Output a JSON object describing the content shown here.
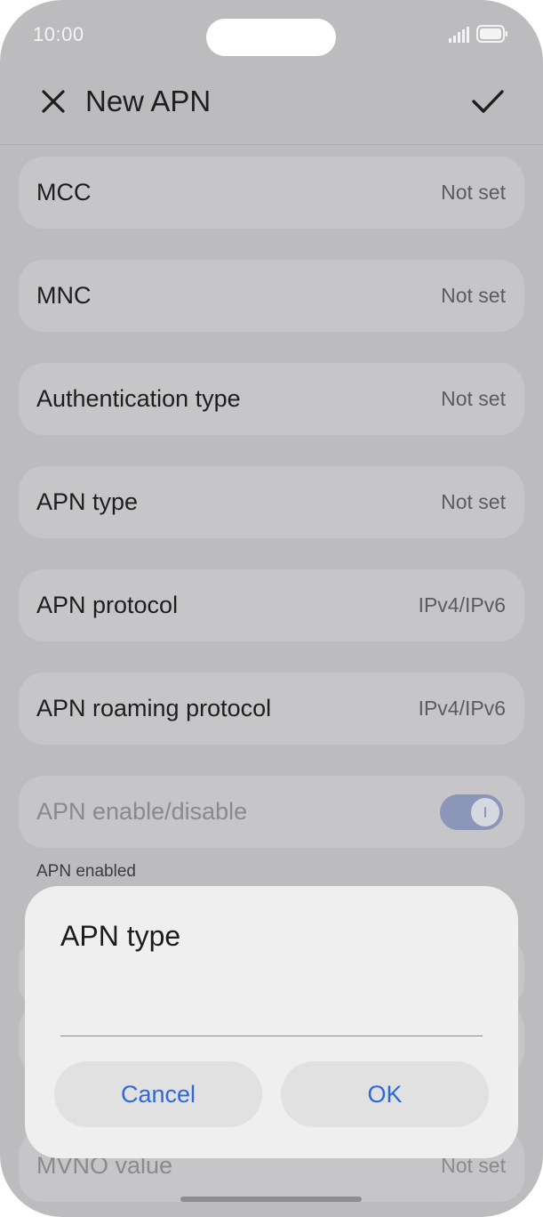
{
  "status_bar": {
    "time": "10:00",
    "signal_icon": "signal-bars-icon",
    "battery_icon": "battery-icon"
  },
  "header": {
    "close_icon": "close-icon",
    "title": "New APN",
    "confirm_icon": "checkmark-icon"
  },
  "settings": {
    "mcc": {
      "label": "MCC",
      "value": "Not set"
    },
    "mnc": {
      "label": "MNC",
      "value": "Not set"
    },
    "auth_type": {
      "label": "Authentication type",
      "value": "Not set"
    },
    "apn_type": {
      "label": "APN type",
      "value": "Not set"
    },
    "apn_protocol": {
      "label": "APN protocol",
      "value": "IPv4/IPv6"
    },
    "apn_roaming_protocol": {
      "label": "APN roaming protocol",
      "value": "IPv4/IPv6"
    },
    "apn_enable": {
      "label": "APN enable/disable",
      "enabled": true,
      "caption": "APN enabled"
    },
    "mvno_value": {
      "label": "MVNO value",
      "value": "Not set"
    }
  },
  "dialog": {
    "title": "APN type",
    "input_value": "",
    "cancel_label": "Cancel",
    "ok_label": "OK"
  },
  "colors": {
    "accent": "#2f68d8",
    "scrim_background": "#bcbcbe",
    "dialog_background": "#efefef"
  }
}
